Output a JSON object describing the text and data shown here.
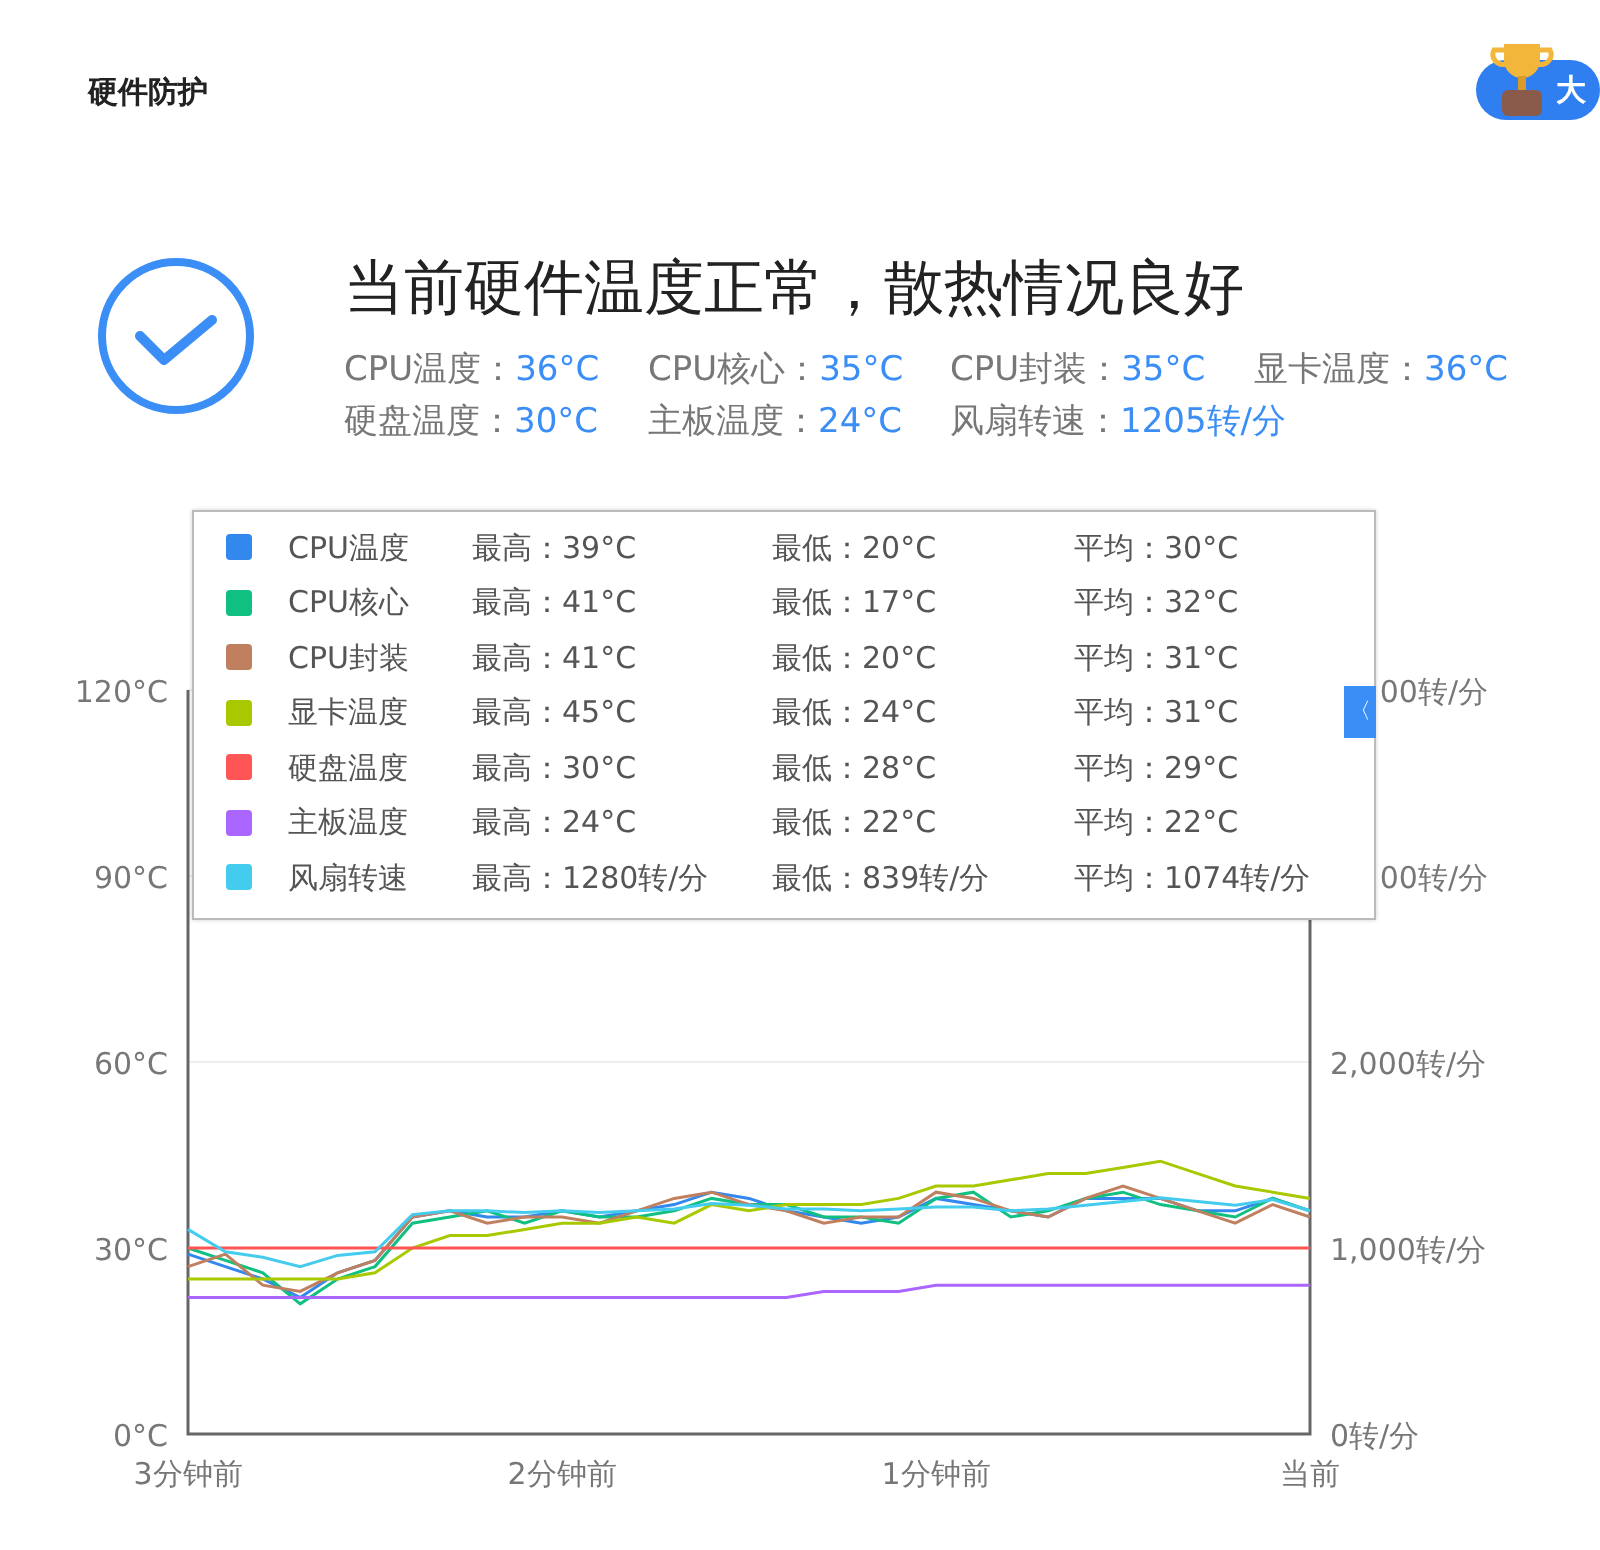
{
  "header": {
    "title": "硬件防护",
    "badge": "大"
  },
  "status": {
    "headline": "当前硬件温度正常，散热情况良好",
    "readings": [
      {
        "label": "CPU温度：",
        "value": "36°C"
      },
      {
        "label": "CPU核心：",
        "value": "35°C"
      },
      {
        "label": "CPU封装：",
        "value": "35°C"
      },
      {
        "label": "显卡温度：",
        "value": "36°C"
      },
      {
        "label": "硬盘温度：",
        "value": "30°C"
      },
      {
        "label": "主板温度：",
        "value": "24°C"
      },
      {
        "label": "风扇转速：",
        "value": "1205转/分"
      }
    ]
  },
  "chart": {
    "chart_data": {
      "type": "line",
      "x": [
        3,
        2.9,
        2.8,
        2.7,
        2.6,
        2.5,
        2.4,
        2.3,
        2.2,
        2.1,
        2,
        1.9,
        1.8,
        1.7,
        1.6,
        1.5,
        1.4,
        1.3,
        1.2,
        1.1,
        1,
        0.9,
        0.8,
        0.7,
        0.6,
        0.5,
        0.4,
        0.3,
        0.2,
        0.1,
        0
      ],
      "xlim": [
        3,
        0
      ],
      "xticks": [
        {
          "value": 3,
          "label": "3分钟前"
        },
        {
          "value": 2,
          "label": "2分钟前"
        },
        {
          "value": 1,
          "label": "1分钟前"
        },
        {
          "value": 0,
          "label": "当前"
        }
      ],
      "y2lim": [
        0,
        4000
      ],
      "y2ticks": [
        {
          "value": 0,
          "label": "0转/分"
        },
        {
          "value": 1000,
          "label": "1,000转/分"
        },
        {
          "value": 2000,
          "label": "2,000转/分"
        }
      ],
      "ylim": [
        0,
        120
      ],
      "yticks": [
        {
          "value": 0,
          "label": "0°C"
        },
        {
          "value": 30,
          "label": "30°C"
        },
        {
          "value": 60,
          "label": "60°C"
        },
        {
          "value": 90,
          "label": "90°C"
        },
        {
          "value": 120,
          "label": "120°C"
        }
      ],
      "series": [
        {
          "name": "CPU温度",
          "color": "#3388ee",
          "values": [
            29,
            27,
            25,
            22,
            26,
            28,
            35,
            36,
            35,
            35,
            36,
            35,
            36,
            37,
            39,
            38,
            36,
            35,
            34,
            35,
            38,
            37,
            36,
            35,
            38,
            38,
            38,
            36,
            36,
            38,
            36
          ]
        },
        {
          "name": "CPU核心",
          "color": "#10c080",
          "values": [
            30,
            28,
            26,
            21,
            25,
            27,
            34,
            35,
            36,
            34,
            36,
            35,
            35,
            36,
            38,
            37,
            37,
            35,
            35,
            34,
            38,
            39,
            35,
            36,
            38,
            39,
            37,
            36,
            35,
            38,
            36
          ]
        },
        {
          "name": "CPU封装",
          "color": "#c08060",
          "values": [
            27,
            29,
            24,
            23,
            26,
            28,
            35,
            36,
            34,
            35,
            35,
            34,
            36,
            38,
            39,
            37,
            36,
            34,
            35,
            35,
            39,
            38,
            36,
            35,
            38,
            40,
            38,
            36,
            34,
            37,
            35
          ]
        },
        {
          "name": "显卡温度",
          "color": "#aac800",
          "values": [
            25,
            25,
            25,
            25,
            25,
            26,
            30,
            32,
            32,
            33,
            34,
            34,
            35,
            34,
            37,
            36,
            37,
            37,
            37,
            38,
            40,
            40,
            41,
            42,
            42,
            43,
            44,
            42,
            40,
            39,
            38
          ]
        },
        {
          "name": "硬盘温度",
          "color": "#ff5555",
          "values": [
            30,
            30,
            30,
            30,
            30,
            30,
            30,
            30,
            30,
            30,
            30,
            30,
            30,
            30,
            30,
            30,
            30,
            30,
            30,
            30,
            30,
            30,
            30,
            30,
            30,
            30,
            30,
            30,
            30,
            30,
            30
          ]
        },
        {
          "name": "主板温度",
          "color": "#aa66ff",
          "values": [
            22,
            22,
            22,
            22,
            22,
            22,
            22,
            22,
            22,
            22,
            22,
            22,
            22,
            22,
            22,
            22,
            22,
            23,
            23,
            23,
            24,
            24,
            24,
            24,
            24,
            24,
            24,
            24,
            24,
            24,
            24
          ]
        },
        {
          "name": "风扇转速",
          "color": "#44ccee",
          "axis": "y2",
          "values": [
            1100,
            980,
            950,
            900,
            960,
            980,
            1180,
            1200,
            1200,
            1190,
            1200,
            1190,
            1200,
            1210,
            1240,
            1230,
            1210,
            1210,
            1200,
            1210,
            1220,
            1220,
            1200,
            1210,
            1230,
            1250,
            1270,
            1250,
            1230,
            1260,
            1200
          ]
        }
      ]
    },
    "legend": [
      {
        "max": "最高：39°C",
        "min": "最低：20°C",
        "avg": "平均：30°C"
      },
      {
        "max": "最高：41°C",
        "min": "最低：17°C",
        "avg": "平均：32°C"
      },
      {
        "max": "最高：41°C",
        "min": "最低：20°C",
        "avg": "平均：31°C"
      },
      {
        "max": "最高：45°C",
        "min": "最低：24°C",
        "avg": "平均：31°C"
      },
      {
        "max": "最高：30°C",
        "min": "最低：28°C",
        "avg": "平均：29°C"
      },
      {
        "max": "最高：24°C",
        "min": "最低：22°C",
        "avg": "平均：22°C"
      },
      {
        "max": "最高：1280转/分",
        "min": "最低：839转/分",
        "avg": "平均：1074转/分"
      }
    ],
    "covered_axis_labels": [
      "00转/分",
      "00转/分"
    ],
    "collapse_tab": "〈"
  }
}
